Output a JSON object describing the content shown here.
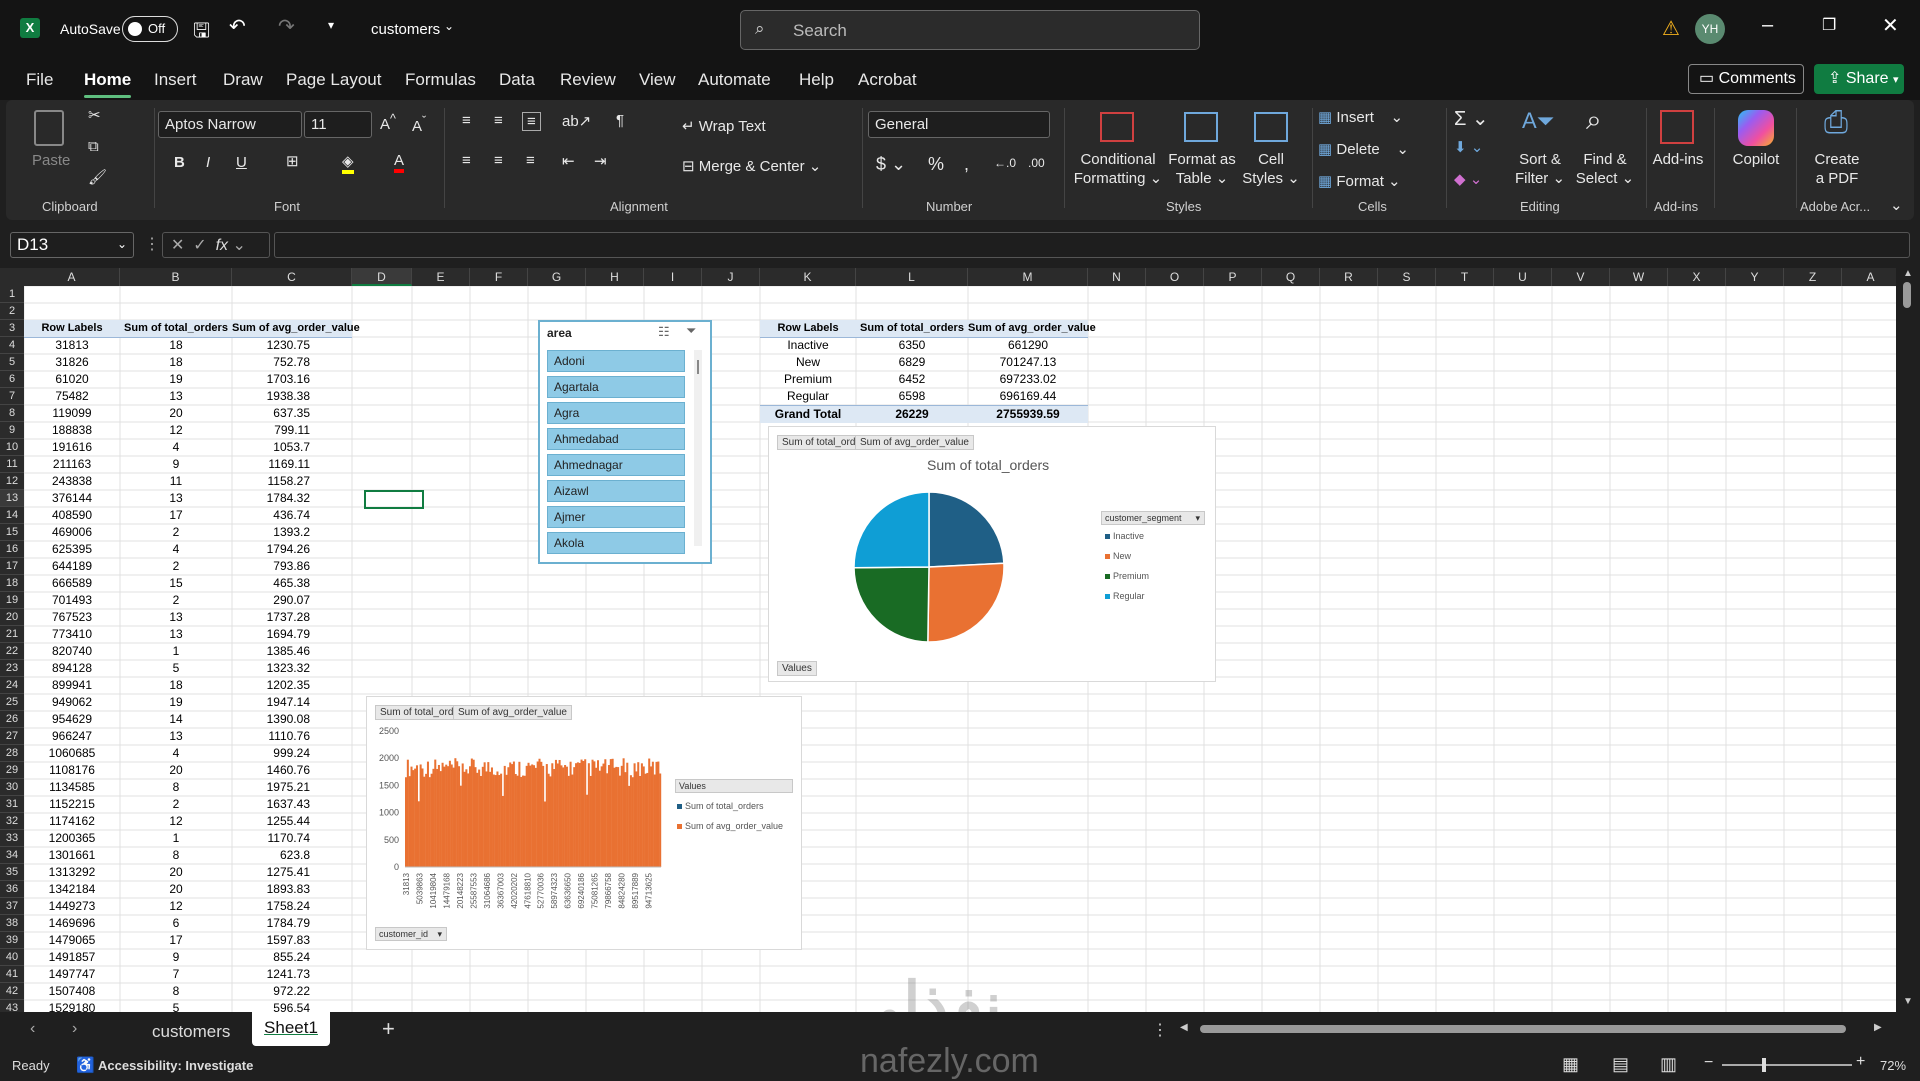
{
  "titlebar": {
    "autosave": "AutoSave",
    "autosave_state": "Off",
    "filename": "customers",
    "search_placeholder": "Search",
    "avatar": "YH"
  },
  "menu": [
    "File",
    "Home",
    "Insert",
    "Draw",
    "Page Layout",
    "Formulas",
    "Data",
    "Review",
    "View",
    "Automate",
    "Help",
    "Acrobat"
  ],
  "menu_active": "Home",
  "comments_label": "Comments",
  "share_label": "Share",
  "ribbon": {
    "paste": "Paste",
    "clipboard": "Clipboard",
    "font_name": "Aptos Narrow",
    "font_size": "11",
    "font": "Font",
    "wrap_text": "Wrap Text",
    "merge_center": "Merge & Center",
    "alignment": "Alignment",
    "number_format": "General",
    "number": "Number",
    "cond_fmt_1": "Conditional",
    "cond_fmt_2": "Formatting",
    "fmt_table_1": "Format as",
    "fmt_table_2": "Table",
    "cell_styles_1": "Cell",
    "cell_styles_2": "Styles",
    "styles": "Styles",
    "insert": "Insert",
    "delete": "Delete",
    "format": "Format",
    "cells": "Cells",
    "sort_1": "Sort &",
    "sort_2": "Filter",
    "find_1": "Find &",
    "find_2": "Select",
    "editing": "Editing",
    "addins": "Add-ins",
    "addins_group": "Add-ins",
    "copilot": "Copilot",
    "create_pdf_1": "Create",
    "create_pdf_2": "a PDF",
    "adobe": "Adobe Acr..."
  },
  "namebox": "D13",
  "columns": [
    "A",
    "B",
    "C",
    "D",
    "E",
    "F",
    "G",
    "H",
    "I",
    "J",
    "K",
    "L",
    "M",
    "N",
    "O",
    "P",
    "Q",
    "R",
    "S",
    "T",
    "U",
    "V",
    "W",
    "X",
    "Y",
    "Z",
    "A"
  ],
  "pivot1": {
    "headers": [
      "Row Labels",
      "Sum of total_orders",
      "Sum of avg_order_value"
    ],
    "rows": [
      [
        "31813",
        "18",
        "1230.75"
      ],
      [
        "31826",
        "18",
        "752.78"
      ],
      [
        "61020",
        "19",
        "1703.16"
      ],
      [
        "75482",
        "13",
        "1938.38"
      ],
      [
        "119099",
        "20",
        "637.35"
      ],
      [
        "188838",
        "12",
        "799.11"
      ],
      [
        "191616",
        "4",
        "1053.7"
      ],
      [
        "211163",
        "9",
        "1169.11"
      ],
      [
        "243838",
        "11",
        "1158.27"
      ],
      [
        "376144",
        "13",
        "1784.32"
      ],
      [
        "408590",
        "17",
        "436.74"
      ],
      [
        "469006",
        "2",
        "1393.2"
      ],
      [
        "625395",
        "4",
        "1794.26"
      ],
      [
        "644189",
        "2",
        "793.86"
      ],
      [
        "666589",
        "15",
        "465.38"
      ],
      [
        "701493",
        "2",
        "290.07"
      ],
      [
        "767523",
        "13",
        "1737.28"
      ],
      [
        "773410",
        "13",
        "1694.79"
      ],
      [
        "820740",
        "1",
        "1385.46"
      ],
      [
        "894128",
        "5",
        "1323.32"
      ],
      [
        "899941",
        "18",
        "1202.35"
      ],
      [
        "949062",
        "19",
        "1947.14"
      ],
      [
        "954629",
        "14",
        "1390.08"
      ],
      [
        "966247",
        "13",
        "1110.76"
      ],
      [
        "1060685",
        "4",
        "999.24"
      ],
      [
        "1108176",
        "20",
        "1460.76"
      ],
      [
        "1134585",
        "8",
        "1975.21"
      ],
      [
        "1152215",
        "2",
        "1637.43"
      ],
      [
        "1174162",
        "12",
        "1255.44"
      ],
      [
        "1200365",
        "1",
        "1170.74"
      ],
      [
        "1301661",
        "8",
        "623.8"
      ],
      [
        "1313292",
        "20",
        "1275.41"
      ],
      [
        "1342184",
        "20",
        "1893.83"
      ],
      [
        "1449273",
        "12",
        "1758.24"
      ],
      [
        "1469696",
        "6",
        "1784.79"
      ],
      [
        "1479065",
        "17",
        "1597.83"
      ],
      [
        "1491857",
        "9",
        "855.24"
      ],
      [
        "1497747",
        "7",
        "1241.73"
      ],
      [
        "1507408",
        "8",
        "972.22"
      ],
      [
        "1529180",
        "5",
        "596.54"
      ]
    ]
  },
  "slicer": {
    "title": "area",
    "items": [
      "Adoni",
      "Agartala",
      "Agra",
      "Ahmedabad",
      "Ahmednagar",
      "Aizawl",
      "Ajmer",
      "Akola"
    ]
  },
  "pivot2": {
    "headers": [
      "Row Labels",
      "Sum of total_orders",
      "Sum of avg_order_value"
    ],
    "rows": [
      [
        "Inactive",
        "6350",
        "661290"
      ],
      [
        "New",
        "6829",
        "701247.13"
      ],
      [
        "Premium",
        "6452",
        "697233.02"
      ],
      [
        "Regular",
        "6598",
        "696169.44"
      ]
    ],
    "total": [
      "Grand Total",
      "26229",
      "2755939.59"
    ]
  },
  "pie_chart": {
    "pills": [
      "Sum of total_orders",
      "Sum of avg_order_value"
    ],
    "values_pill": "Values",
    "legend_field": "customer_segment"
  },
  "bar_chart": {
    "pills": [
      "Sum of total_orders",
      "Sum of avg_order_value"
    ],
    "legend_title": "Values",
    "field_pill": "customer_id",
    "x_labels": [
      "31813",
      "5039863",
      "10419804",
      "14479168",
      "20148223",
      "25587553",
      "31064686",
      "36367003",
      "42020202",
      "47618810",
      "52770036",
      "58974323",
      "63636650",
      "69240186",
      "75081265",
      "79866758",
      "84824280",
      "89517889",
      "94713625"
    ]
  },
  "chart_data": [
    {
      "type": "pie",
      "title": "Sum of total_orders",
      "categories": [
        "Inactive",
        "New",
        "Premium",
        "Regular"
      ],
      "values": [
        6350,
        6829,
        6452,
        6598
      ],
      "colors": [
        "#1f5f86",
        "#e97132",
        "#196b24",
        "#0f9ed5"
      ],
      "legend": "right"
    },
    {
      "type": "bar",
      "ylim": [
        0,
        2500
      ],
      "yticks": [
        "0",
        "500",
        "1000",
        "1500",
        "2000",
        "2500"
      ],
      "series": [
        {
          "name": "Sum of total_orders",
          "color": "#1f5f86"
        },
        {
          "name": "Sum of avg_order_value",
          "color": "#e97132"
        }
      ],
      "note_values_range": [
        1200,
        2000
      ],
      "legend": "right"
    }
  ],
  "sheets": [
    "customers",
    "Sheet1"
  ],
  "active_sheet": "Sheet1",
  "status": {
    "ready": "Ready",
    "accessibility": "Accessibility: Investigate",
    "zoom": "72%"
  },
  "watermark": {
    "logo": "نفذلي",
    "url": "nafezly.com"
  }
}
